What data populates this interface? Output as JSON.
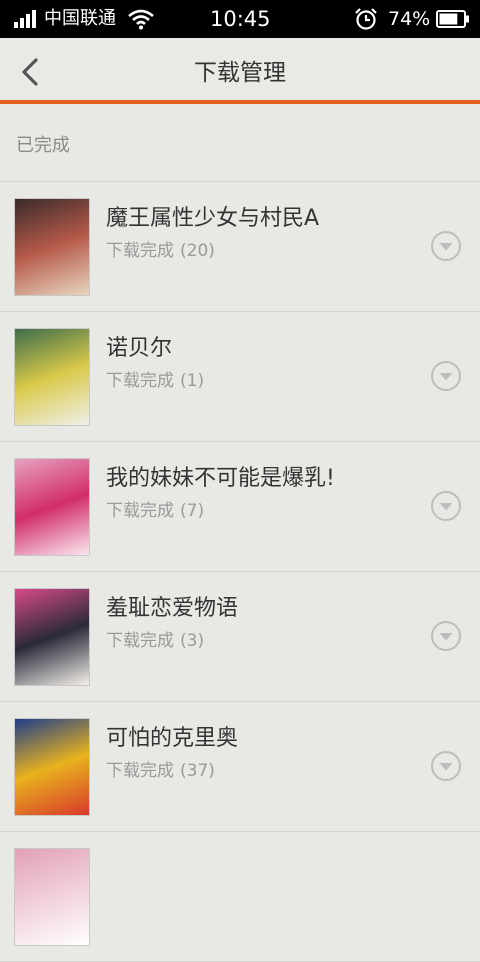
{
  "status_bar": {
    "carrier": "中国联通",
    "time": "10:45",
    "battery": "74%",
    "battery_level": 0.74
  },
  "header": {
    "title": "下载管理",
    "back_icon": "chevron-left-icon"
  },
  "section": {
    "label": "已完成"
  },
  "items": [
    {
      "title": "魔王属性少女与村民A",
      "status": "下载完成",
      "count": "(20)",
      "cover_colors": [
        "#3a2a2a",
        "#b65a4a",
        "#e8d6c0"
      ]
    },
    {
      "title": "诺贝尔",
      "status": "下载完成",
      "count": "(1)",
      "cover_colors": [
        "#3e6d4a",
        "#d9c94a",
        "#f0f0ea"
      ]
    },
    {
      "title": "我的妹妹不可能是爆乳!",
      "status": "下载完成",
      "count": "(7)",
      "cover_colors": [
        "#e7a2c0",
        "#d12d6a",
        "#fbe8f0"
      ]
    },
    {
      "title": "羞耻恋爱物语",
      "status": "下载完成",
      "count": "(3)",
      "cover_colors": [
        "#d84a8a",
        "#2a2a3a",
        "#f4f0ea"
      ]
    },
    {
      "title": "可怕的克里奥",
      "status": "下载完成",
      "count": "(37)",
      "cover_colors": [
        "#1e3e8a",
        "#e8b21e",
        "#d83a2a"
      ]
    }
  ],
  "partial_item": {
    "cover_colors": [
      "#e2a0b8",
      "#ffffff"
    ]
  }
}
